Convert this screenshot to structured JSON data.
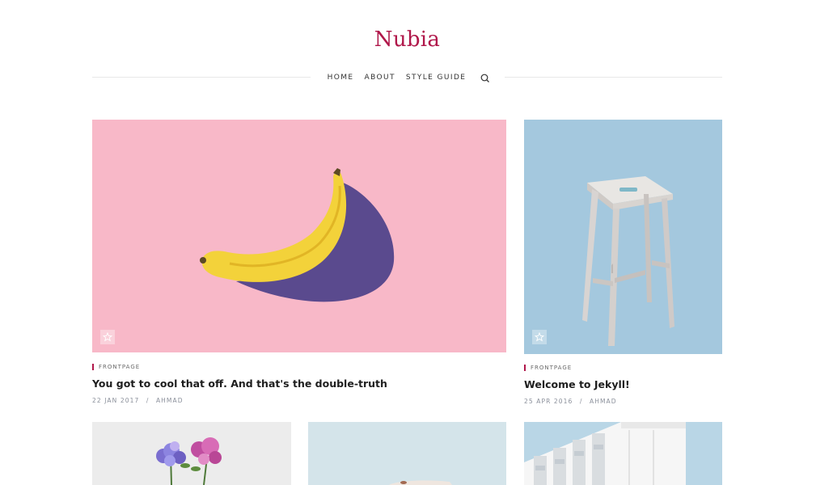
{
  "site": {
    "title": "Nubia"
  },
  "nav": {
    "items": [
      "HOME",
      "ABOUT",
      "STYLE GUIDE"
    ]
  },
  "posts": [
    {
      "category": "FRONTPAGE",
      "title": "You got to cool that off. And that's the double-truth",
      "date": "22 JAN 2017",
      "author": "AHMAD",
      "separator": "/"
    },
    {
      "category": "FRONTPAGE",
      "title": "Welcome to Jekyll!",
      "date": "25 APR 2016",
      "author": "AHMAD",
      "separator": "/"
    }
  ],
  "colors": {
    "accent": "#b0174a",
    "pink_bg": "#f8b8c8",
    "blue_bg": "#a4c8de",
    "grey_bg": "#ececec"
  }
}
